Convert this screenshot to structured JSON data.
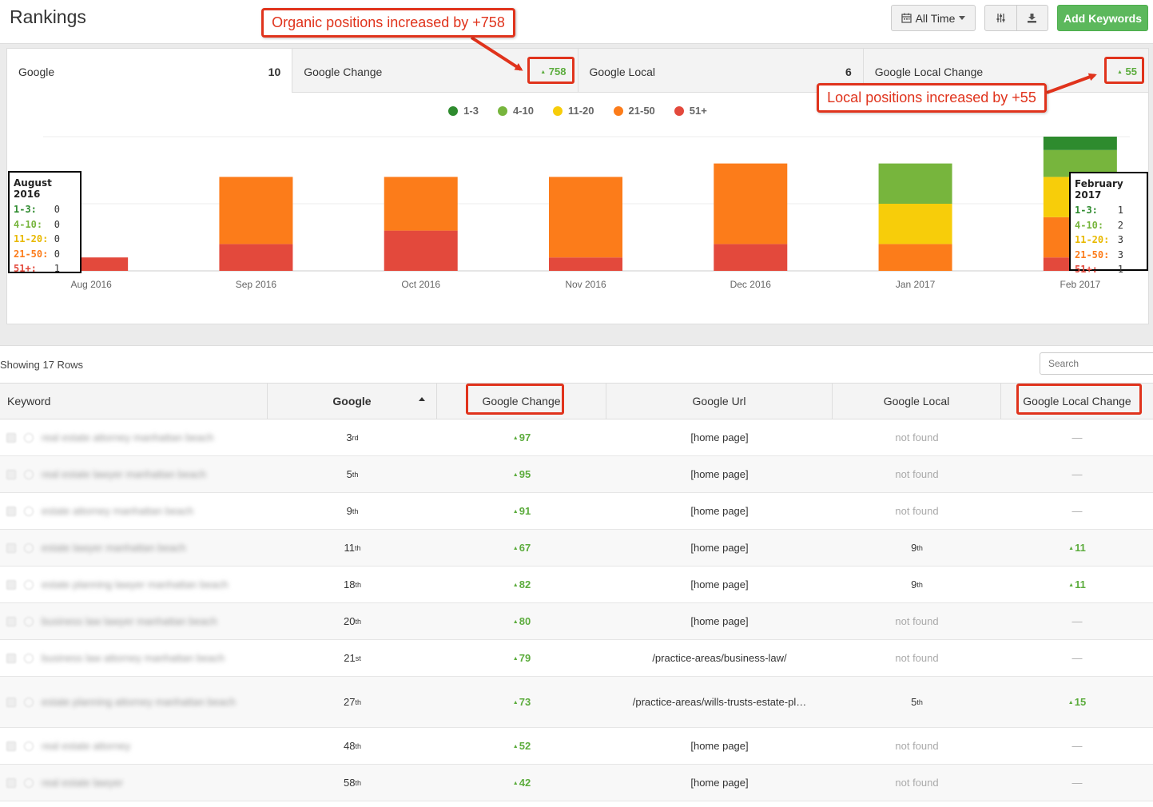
{
  "header": {
    "title": "Rankings",
    "time_button": "All Time",
    "add_button": "Add Keywords"
  },
  "stats": [
    {
      "label": "Google",
      "value": "10"
    },
    {
      "label": "Google Change",
      "value": "758"
    },
    {
      "label": "Google Local",
      "value": "6"
    },
    {
      "label": "Google Local Change",
      "value": "55"
    }
  ],
  "callouts": {
    "organic": "Organic positions increased by +758",
    "local": "Local positions increased by +55"
  },
  "colors": {
    "r1_3": "#2e8b2e",
    "r4_10": "#77b53d",
    "r11_20": "#f7cd0a",
    "r21_50": "#fc7c1a",
    "r51": "#e3493c",
    "accent_green": "#5cb85c",
    "callout_red": "#e0331c"
  },
  "chart_data": {
    "type": "bar",
    "stacked": true,
    "categories": [
      "Aug 2016",
      "Sep 2016",
      "Oct 2016",
      "Nov 2016",
      "Dec 2016",
      "Jan 2017",
      "Feb 2017"
    ],
    "series": [
      {
        "name": "51+",
        "color": "#e3493c",
        "values": [
          1,
          2,
          3,
          1,
          2,
          0,
          1
        ]
      },
      {
        "name": "21-50",
        "color": "#fc7c1a",
        "values": [
          0,
          5,
          4,
          6,
          6,
          2,
          3
        ]
      },
      {
        "name": "11-20",
        "color": "#f7cd0a",
        "values": [
          0,
          0,
          0,
          0,
          0,
          3,
          3
        ]
      },
      {
        "name": "4-10",
        "color": "#77b53d",
        "values": [
          0,
          0,
          0,
          0,
          0,
          3,
          2
        ]
      },
      {
        "name": "1-3",
        "color": "#2e8b2e",
        "values": [
          0,
          0,
          0,
          0,
          0,
          0,
          1
        ]
      }
    ],
    "legend": [
      "1-3",
      "4-10",
      "11-20",
      "21-50",
      "51+"
    ],
    "ylim": [
      0,
      10
    ],
    "grid": true,
    "legend_position": "top-center"
  },
  "tooltips": {
    "left": {
      "title": "August 2016",
      "rows": [
        {
          "k": "1-3:",
          "v": "0"
        },
        {
          "k": "4-10:",
          "v": "0"
        },
        {
          "k": "11-20:",
          "v": "0"
        },
        {
          "k": "21-50:",
          "v": "0"
        },
        {
          "k": "51+:",
          "v": "1"
        }
      ]
    },
    "right": {
      "title": "February 2017",
      "rows": [
        {
          "k": "1-3:",
          "v": "1"
        },
        {
          "k": "4-10:",
          "v": "2"
        },
        {
          "k": "11-20:",
          "v": "3"
        },
        {
          "k": "21-50:",
          "v": "3"
        },
        {
          "k": "51+:",
          "v": "1"
        }
      ]
    }
  },
  "table": {
    "showing": "Showing 17 Rows",
    "search_placeholder": "Search",
    "columns": [
      "Keyword",
      "Google",
      "Google Change",
      "Google Url",
      "Google Local",
      "Google Local Change"
    ],
    "rows": [
      {
        "keyword": "real estate attorney manhattan beach",
        "google_n": "3",
        "google_s": "rd",
        "change": "97",
        "url": "[home page]",
        "local_n": "not found",
        "local_s": "",
        "local_change": "—"
      },
      {
        "keyword": "real estate lawyer manhattan beach",
        "google_n": "5",
        "google_s": "th",
        "change": "95",
        "url": "[home page]",
        "local_n": "not found",
        "local_s": "",
        "local_change": "—"
      },
      {
        "keyword": "estate attorney manhattan beach",
        "google_n": "9",
        "google_s": "th",
        "change": "91",
        "url": "[home page]",
        "local_n": "not found",
        "local_s": "",
        "local_change": "—"
      },
      {
        "keyword": "estate lawyer manhattan beach",
        "google_n": "11",
        "google_s": "th",
        "change": "67",
        "url": "[home page]",
        "local_n": "9",
        "local_s": "th",
        "local_change": "11"
      },
      {
        "keyword": "estate planning lawyer manhattan beach",
        "google_n": "18",
        "google_s": "th",
        "change": "82",
        "url": "[home page]",
        "local_n": "9",
        "local_s": "th",
        "local_change": "11"
      },
      {
        "keyword": "business law lawyer manhattan beach",
        "google_n": "20",
        "google_s": "th",
        "change": "80",
        "url": "[home page]",
        "local_n": "not found",
        "local_s": "",
        "local_change": "—"
      },
      {
        "keyword": "business law attorney manhattan beach",
        "google_n": "21",
        "google_s": "st",
        "change": "79",
        "url": "/practice-areas/business-law/",
        "local_n": "not found",
        "local_s": "",
        "local_change": "—"
      },
      {
        "keyword": "estate planning attorney manhattan beach",
        "google_n": "27",
        "google_s": "th",
        "change": "73",
        "url": "/practice-areas/wills-trusts-estate-pl…",
        "local_n": "5",
        "local_s": "th",
        "local_change": "15"
      },
      {
        "keyword": "real estate attorney",
        "google_n": "48",
        "google_s": "th",
        "change": "52",
        "url": "[home page]",
        "local_n": "not found",
        "local_s": "",
        "local_change": "—"
      },
      {
        "keyword": "real estate lawyer",
        "google_n": "58",
        "google_s": "th",
        "change": "42",
        "url": "[home page]",
        "local_n": "not found",
        "local_s": "",
        "local_change": "—"
      }
    ]
  }
}
